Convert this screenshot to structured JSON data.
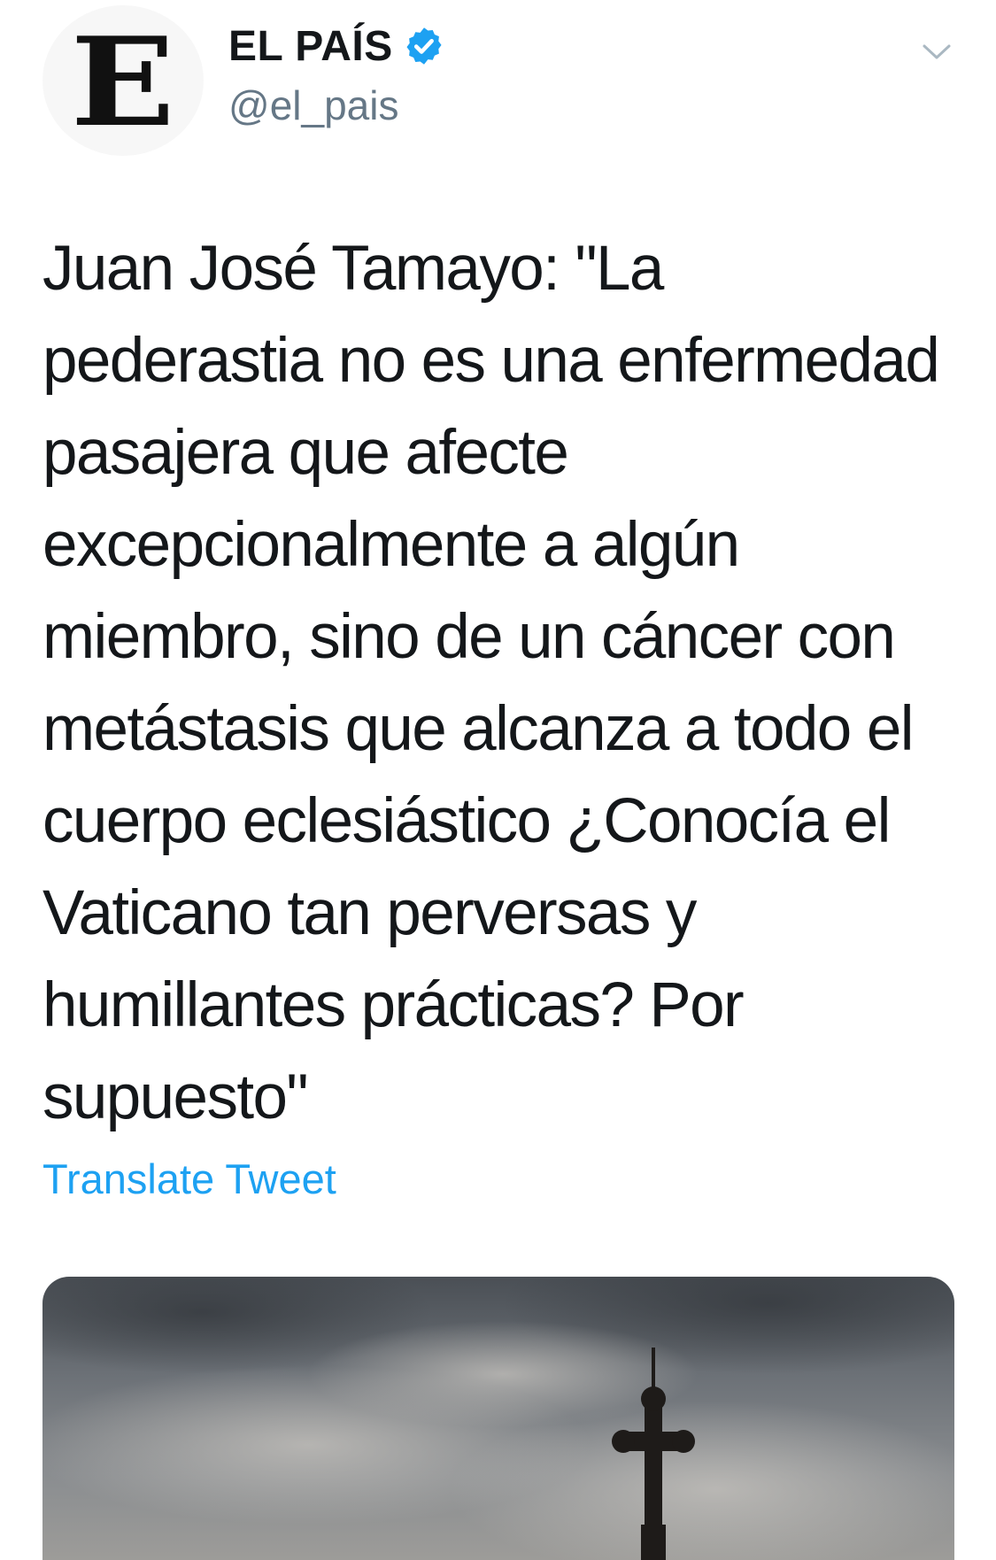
{
  "account": {
    "display_name": "EL PAÍS",
    "handle": "@el_pais",
    "avatar_letter": "E",
    "verified": true,
    "verified_color": "#1da1f2"
  },
  "tweet": {
    "text": "Juan José Tamayo: \"La\npederastia no es una enfermedad\npasajera que afecte\nexcepcionalmente a algún\nmiembro, sino de un cáncer con\nmetástasis que alcanza a todo el\ncuerpo eclesiástico ¿Conocía el\nVaticano tan perversas y\nhumillantes prácticas? Por\nsupuesto\"",
    "translate_label": "Translate Tweet"
  },
  "media": {
    "icon": "church-cross-photo"
  },
  "icons": {
    "verified": "verified-badge-icon",
    "menu": "chevron-down-icon"
  },
  "colors": {
    "text": "#14171a",
    "secondary": "#657786",
    "link": "#1da1f2"
  }
}
